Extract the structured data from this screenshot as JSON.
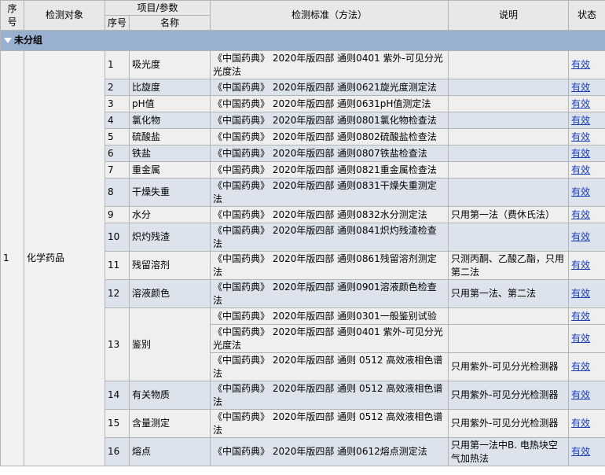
{
  "header": {
    "seq": "序号",
    "object": "检测对象",
    "item_param": "项目/参数",
    "item_seq": "序号",
    "item_name": "名称",
    "standard": "检测标准（方法）",
    "note": "说明",
    "status": "状态"
  },
  "group": {
    "label": "未分组"
  },
  "object_row": {
    "seq": "1",
    "name": "化学药品"
  },
  "rows": [
    {
      "seq": "1",
      "name": "吸光度",
      "standards": [
        {
          "text": "《中国药典》 2020年版四部 通则0401 紫外-可见分光光度法",
          "note": "",
          "status": "有效"
        }
      ]
    },
    {
      "seq": "2",
      "name": "比旋度",
      "standards": [
        {
          "text": "《中国药典》 2020年版四部 通则0621旋光度测定法",
          "note": "",
          "status": "有效"
        }
      ]
    },
    {
      "seq": "3",
      "name": "pH值",
      "standards": [
        {
          "text": "《中国药典》 2020年版四部 通则0631pH值测定法",
          "note": "",
          "status": "有效"
        }
      ]
    },
    {
      "seq": "4",
      "name": "氯化物",
      "standards": [
        {
          "text": "《中国药典》 2020年版四部 通则0801氯化物检查法",
          "note": "",
          "status": "有效"
        }
      ]
    },
    {
      "seq": "5",
      "name": "硫酸盐",
      "standards": [
        {
          "text": "《中国药典》 2020年版四部 通则0802硫酸盐检查法",
          "note": "",
          "status": "有效"
        }
      ]
    },
    {
      "seq": "6",
      "name": "铁盐",
      "standards": [
        {
          "text": "《中国药典》 2020年版四部 通则0807铁盐检查法",
          "note": "",
          "status": "有效"
        }
      ]
    },
    {
      "seq": "7",
      "name": "重金属",
      "standards": [
        {
          "text": "《中国药典》 2020年版四部 通则0821重金属检查法",
          "note": "",
          "status": "有效"
        }
      ]
    },
    {
      "seq": "8",
      "name": "干燥失重",
      "standards": [
        {
          "text": "《中国药典》 2020年版四部 通则0831干燥失重测定法",
          "note": "",
          "status": "有效"
        }
      ]
    },
    {
      "seq": "9",
      "name": "水分",
      "standards": [
        {
          "text": "《中国药典》 2020年版四部 通则0832水分测定法",
          "note": "只用第一法（费休氏法）",
          "status": "有效"
        }
      ]
    },
    {
      "seq": "10",
      "name": "炽灼残渣",
      "standards": [
        {
          "text": "《中国药典》 2020年版四部 通则0841炽灼残渣检查法",
          "note": "",
          "status": "有效"
        }
      ]
    },
    {
      "seq": "11",
      "name": "残留溶剂",
      "standards": [
        {
          "text": "《中国药典》 2020年版四部 通则0861残留溶剂测定法",
          "note": "只测丙酮、乙酸乙酯，只用第二法",
          "status": "有效"
        }
      ]
    },
    {
      "seq": "12",
      "name": "溶液颜色",
      "standards": [
        {
          "text": "《中国药典》 2020年版四部 通则0901溶液颜色检查法",
          "note": "只用第一法、第二法",
          "status": "有效"
        }
      ]
    },
    {
      "seq": "13",
      "name": "鉴别",
      "standards": [
        {
          "text": "《中国药典》 2020年版四部 通则0301一般鉴别试验",
          "note": "",
          "status": "有效"
        },
        {
          "text": "《中国药典》 2020年版四部 通则0401 紫外-可见分光光度法",
          "note": "",
          "status": "有效"
        },
        {
          "text": "《中国药典》 2020年版四部 通则 0512 高效液相色谱法",
          "note": "只用紫外-可见分光检测器",
          "status": "有效"
        }
      ]
    },
    {
      "seq": "14",
      "name": "有关物质",
      "standards": [
        {
          "text": "《中国药典》 2020年版四部 通则 0512 高效液相色谱法",
          "note": "只用紫外-可见分光检测器",
          "status": "有效"
        }
      ]
    },
    {
      "seq": "15",
      "name": "含量测定",
      "standards": [
        {
          "text": "《中国药典》 2020年版四部 通则 0512 高效液相色谱法",
          "note": "只用紫外-可见分光检测器",
          "status": "有效"
        }
      ]
    },
    {
      "seq": "16",
      "name": "熔点",
      "standards": [
        {
          "text": "《中国药典》 2020年版四部 通则0612熔点测定法",
          "note": "只用第一法中B. 电热块空气加热法",
          "status": "有效"
        }
      ]
    }
  ]
}
